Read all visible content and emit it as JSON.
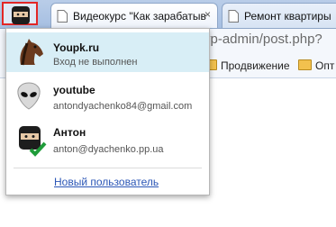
{
  "tabs": [
    {
      "title": "Видеокурс \"Как зарабатыв",
      "close": "×"
    },
    {
      "title": "Ремонт квартиры"
    }
  ],
  "address_bar": {
    "text": "vp-admin/post.php?"
  },
  "bookmarks": [
    {
      "label": "Продвижение"
    },
    {
      "label": "Опт"
    }
  ],
  "profiles": [
    {
      "name": "Youpk.ru",
      "detail": "Вход не выполнен",
      "avatar": "horse-icon",
      "active": true
    },
    {
      "name": "youtube",
      "detail": "antondyachenko84@gmail.com",
      "avatar": "alien-icon",
      "active": false
    },
    {
      "name": "Антон",
      "detail": "anton@dyachenko.pp.ua",
      "avatar": "ninja-icon",
      "active": false,
      "signed_in": true
    }
  ],
  "new_user_label": "Новый пользователь",
  "colors": {
    "highlight": "#d8eef6",
    "link": "#2b56b6",
    "profile_button_border": "#e32626",
    "check": "#1f9c3a"
  }
}
